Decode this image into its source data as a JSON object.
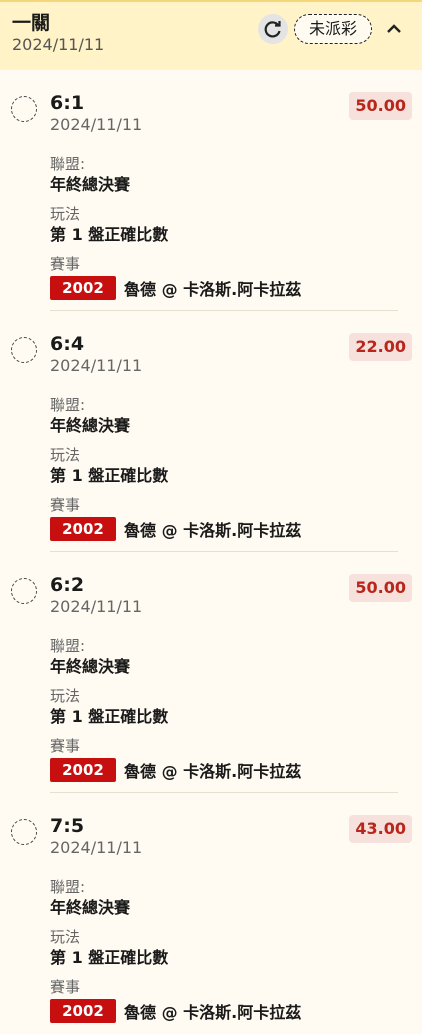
{
  "header": {
    "title": "一關",
    "date": "2024/11/11",
    "status": "未派彩"
  },
  "labels": {
    "league": "聯盟:",
    "play": "玩法",
    "event": "賽事"
  },
  "bets": [
    {
      "score": "6:1",
      "date": "2024/11/11",
      "odds": "50.00",
      "league": "年終總決賽",
      "play": "第 1 盤正確比數",
      "match_id": "2002",
      "teams": "魯德 @ 卡洛斯.阿卡拉茲"
    },
    {
      "score": "6:4",
      "date": "2024/11/11",
      "odds": "22.00",
      "league": "年終總決賽",
      "play": "第 1 盤正確比數",
      "match_id": "2002",
      "teams": "魯德 @ 卡洛斯.阿卡拉茲"
    },
    {
      "score": "6:2",
      "date": "2024/11/11",
      "odds": "50.00",
      "league": "年終總決賽",
      "play": "第 1 盤正確比數",
      "match_id": "2002",
      "teams": "魯德 @ 卡洛斯.阿卡拉茲"
    },
    {
      "score": "7:5",
      "date": "2024/11/11",
      "odds": "43.00",
      "league": "年終總決賽",
      "play": "第 1 盤正確比數",
      "match_id": "2002",
      "teams": "魯德 @ 卡洛斯.阿卡拉茲"
    }
  ]
}
